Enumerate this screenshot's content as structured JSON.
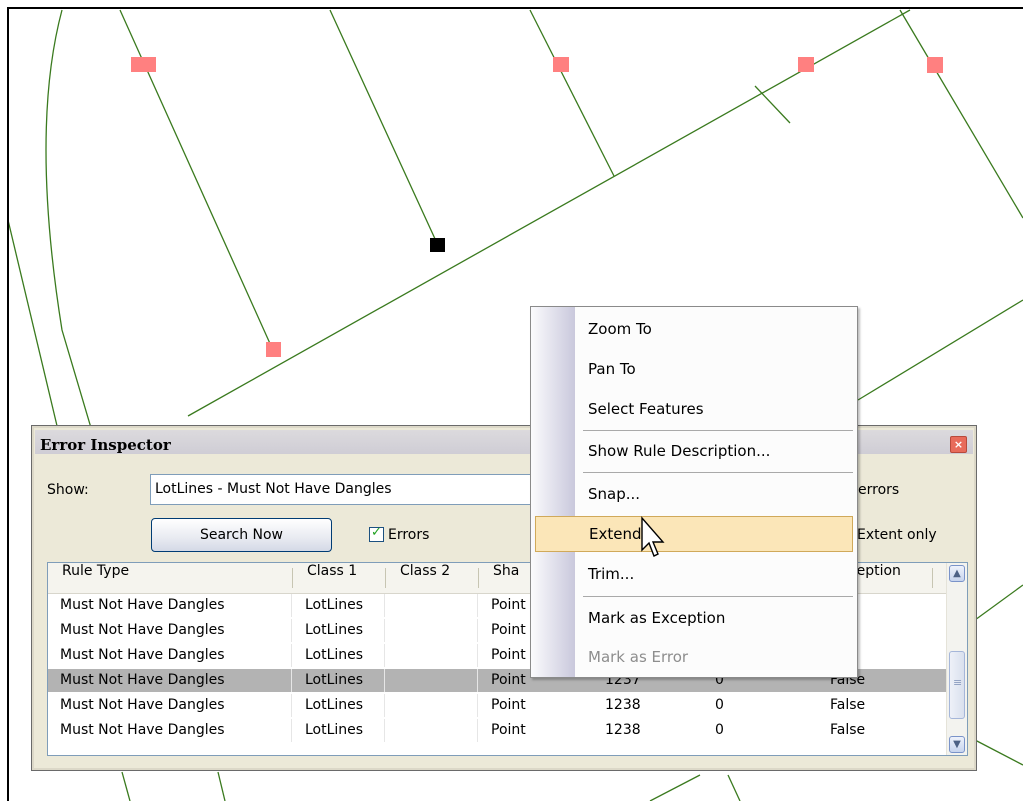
{
  "colors": {
    "map_line": "#3a7a1e",
    "error_point": "#ff8080",
    "selected_point": "#000000",
    "menu_highlight": "#fbe6b8",
    "selected_row": "#b3b3b3"
  },
  "inspector": {
    "title": "Error Inspector",
    "close_icon": "close-icon",
    "show_label": "Show:",
    "show_value": "LotLines - Must Not Have Dangles",
    "errors_suffix": "errors",
    "search_button": "Search Now",
    "errors_checkbox_label": "Errors",
    "errors_checked": true,
    "extent_only_label": "Extent only",
    "columns": [
      "Rule Type",
      "Class 1",
      "Class 2",
      "Sha",
      "Exception"
    ],
    "rows": [
      {
        "rule_type": "Must Not Have Dangles",
        "class1": "LotLines",
        "class2": "",
        "shape": "Point",
        "feature1": "",
        "feature2": "",
        "exception": ""
      },
      {
        "rule_type": "Must Not Have Dangles",
        "class1": "LotLines",
        "class2": "",
        "shape": "Point",
        "feature1": "",
        "feature2": "",
        "exception": ""
      },
      {
        "rule_type": "Must Not Have Dangles",
        "class1": "LotLines",
        "class2": "",
        "shape": "Point",
        "feature1": "",
        "feature2": "",
        "exception": ""
      },
      {
        "rule_type": "Must Not Have Dangles",
        "class1": "LotLines",
        "class2": "",
        "shape": "Point",
        "feature1": "1237",
        "feature2": "0",
        "exception": "False"
      },
      {
        "rule_type": "Must Not Have Dangles",
        "class1": "LotLines",
        "class2": "",
        "shape": "Point",
        "feature1": "1238",
        "feature2": "0",
        "exception": "False"
      },
      {
        "rule_type": "Must Not Have Dangles",
        "class1": "LotLines",
        "class2": "",
        "shape": "Point",
        "feature1": "1238",
        "feature2": "0",
        "exception": "False"
      }
    ],
    "selected_row": 3
  },
  "context_menu": {
    "items": [
      {
        "label": "Zoom To"
      },
      {
        "label": "Pan To"
      },
      {
        "label": "Select Features"
      },
      {
        "label": "Show Rule Description..."
      },
      {
        "label": "Snap..."
      },
      {
        "label": "Extend..."
      },
      {
        "label": "Trim..."
      },
      {
        "label": "Mark as Exception"
      },
      {
        "label": "Mark as Error"
      }
    ],
    "highlighted_item": "Extend...",
    "disabled_item": "Mark as Error"
  }
}
